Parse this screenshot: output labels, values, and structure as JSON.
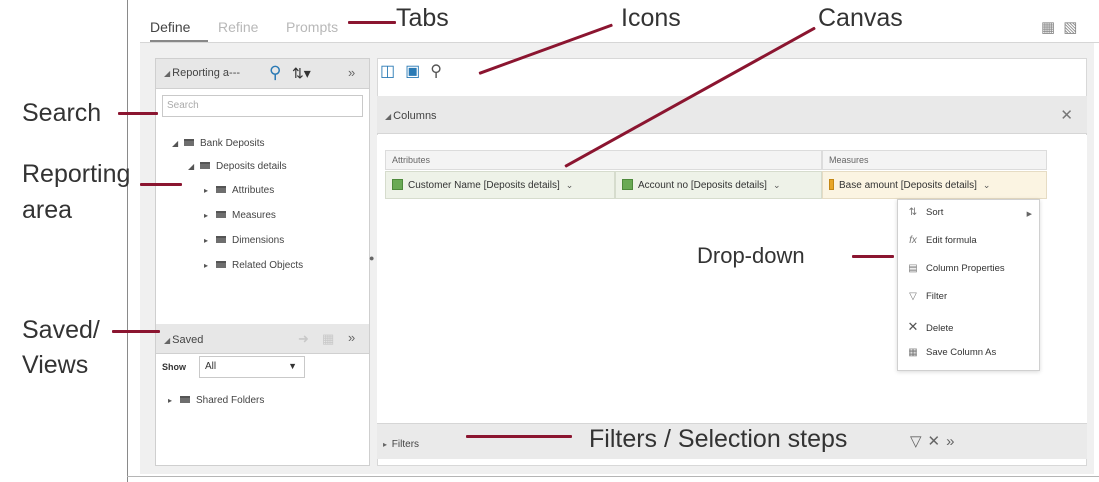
{
  "tabs": [
    {
      "label": "Define",
      "active": true
    },
    {
      "label": "Refine",
      "active": false
    },
    {
      "label": "Prompts",
      "active": false
    }
  ],
  "reporting": {
    "title": "Reporting a---",
    "search_placeholder": "Search",
    "tree": [
      {
        "label": "Bank Deposits"
      },
      {
        "label": "Deposits details"
      },
      {
        "label": "Attributes"
      },
      {
        "label": "Measures"
      },
      {
        "label": "Dimensions"
      },
      {
        "label": "Related Objects"
      }
    ]
  },
  "saved": {
    "title": "Saved",
    "show_label": "Show",
    "show_value": "All",
    "items": [
      {
        "label": "Shared Folders"
      }
    ]
  },
  "canvas": {
    "columns_title": "Columns",
    "attributes_label": "Attributes",
    "measures_label": "Measures",
    "columns": [
      {
        "label": "Customer Name [Deposits details]",
        "kind": "attribute"
      },
      {
        "label": "Account no [Deposits details]",
        "kind": "attribute"
      },
      {
        "label": "Base amount [Deposits details]",
        "kind": "measure"
      }
    ],
    "filters_title": "Filters"
  },
  "dropdown_menu": [
    {
      "label": "Sort",
      "icon": "sort-icon",
      "submenu": true
    },
    {
      "label": "Edit formula",
      "icon": "formula-icon"
    },
    {
      "label": "Column Properties",
      "icon": "column-properties-icon"
    },
    {
      "label": "Filter",
      "icon": "filter-icon"
    },
    {
      "label": "Delete",
      "icon": "delete-icon"
    },
    {
      "label": "Save Column As",
      "icon": "save-icon"
    }
  ],
  "callouts": {
    "tabs": "Tabs",
    "icons": "Icons",
    "canvas": "Canvas",
    "search": "Search",
    "reporting_line1": "Reporting",
    "reporting_line2": "area",
    "saved_line1": "Saved/",
    "saved_line2": "Views",
    "dropdown": "Drop-down",
    "filters": "Filters / Selection steps"
  },
  "colors": {
    "accent": "#2a7ab5",
    "leader": "#8b1530"
  }
}
